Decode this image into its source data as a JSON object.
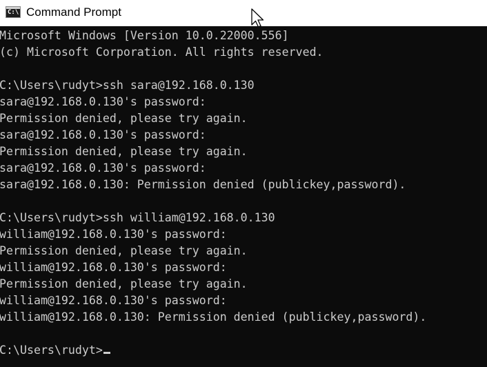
{
  "window": {
    "title": "Command Prompt",
    "app_icon_text": "C:\\",
    "colors": {
      "console_background": "#0c0c0c",
      "console_text": "#cccccc",
      "titlebar_background": "#ffffff"
    }
  },
  "console": {
    "lines": [
      "Microsoft Windows [Version 10.0.22000.556]",
      "(c) Microsoft Corporation. All rights reserved.",
      "",
      "C:\\Users\\rudyt>ssh sara@192.168.0.130",
      "sara@192.168.0.130's password:",
      "Permission denied, please try again.",
      "sara@192.168.0.130's password:",
      "Permission denied, please try again.",
      "sara@192.168.0.130's password:",
      "sara@192.168.0.130: Permission denied (publickey,password).",
      "",
      "C:\\Users\\rudyt>ssh william@192.168.0.130",
      "william@192.168.0.130's password:",
      "Permission denied, please try again.",
      "william@192.168.0.130's password:",
      "Permission denied, please try again.",
      "william@192.168.0.130's password:",
      "william@192.168.0.130: Permission denied (publickey,password).",
      ""
    ],
    "prompt": "C:\\Users\\rudyt>"
  }
}
